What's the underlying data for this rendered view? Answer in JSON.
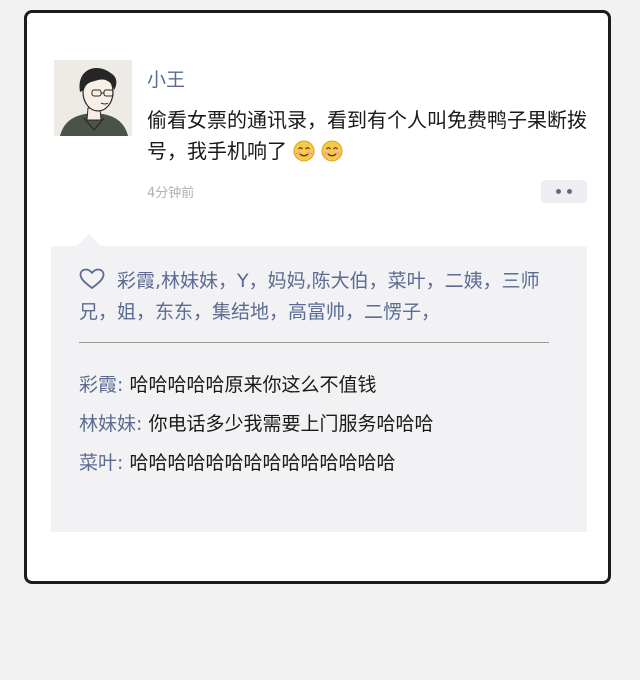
{
  "post": {
    "username": "小王",
    "text": "偷看女票的通讯录，看到有个人叫免费鸭子果断拨号，我手机响了",
    "emojis": [
      "smiling-face-icon",
      "smiling-face-icon"
    ],
    "timestamp": "4分钟前",
    "more_icon": "more-options-icon"
  },
  "likes": {
    "icon": "heart-icon",
    "text": "彩霞,林妹妹，Y，妈妈,陈大伯，菜叶，二姨，三师兄，姐，东东，集结地，高富帅，二愣子，"
  },
  "comments": [
    {
      "author": "彩霞:",
      "text": "哈哈哈哈哈原来你这么不值钱"
    },
    {
      "author": "林妹妹:",
      "text": "你电话多少我需要上门服务哈哈哈"
    },
    {
      "author": "菜叶:",
      "text": "哈哈哈哈哈哈哈哈哈哈哈哈哈哈"
    }
  ],
  "colors": {
    "name_accent": "#5b6b92",
    "body_text": "#1a1a1a",
    "timestamp": "#b0b0b0",
    "panel_background": "#f2f2f4",
    "card_border": "#1c1c1c"
  }
}
